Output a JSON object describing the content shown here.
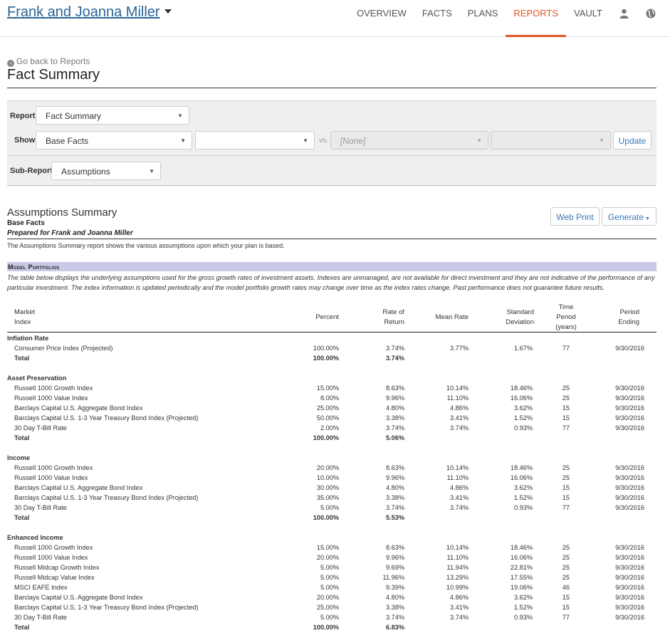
{
  "header": {
    "client_name": "Frank and Joanna Miller",
    "nav": [
      {
        "label": "OVERVIEW",
        "active": false
      },
      {
        "label": "FACTS",
        "active": false
      },
      {
        "label": "PLANS",
        "active": false
      },
      {
        "label": "REPORTS",
        "active": true
      },
      {
        "label": "VAULT",
        "active": false
      }
    ],
    "icons": [
      "user-icon",
      "globe-icon"
    ]
  },
  "page": {
    "back_link": "Go back to Reports",
    "title": "Fact Summary"
  },
  "controls": {
    "report_label": "Report:",
    "report_value": "Fact Summary",
    "show_label": "Show:",
    "show_value": "Base Facts",
    "show_value_2": "",
    "vs_label": "vs.",
    "compare_value": "[None]",
    "compare_value_2": "",
    "update_button": "Update",
    "subreport_label": "Sub-Report:",
    "subreport_value": "Assumptions"
  },
  "report": {
    "title": "Assumptions Summary",
    "subtitle": "Base Facts",
    "prepared_for": "Prepared for Frank and Joanna Miller",
    "description": "The Assumptions Summary report shows the various assumptions upon which your plan is based.",
    "web_print_button": "Web Print",
    "generate_button": "Generate",
    "section_heading": "Model Portfolios",
    "section_note": "The table below displays the underlying assumptions used for the gross growth rates of investment assets. Indexes are unmanaged, are not available for direct investment and they are not indicative of the performance of any particular investment. The index information is updated periodically and the model portfolio growth rates may change over time as the index rates change. Past performance does not guarantee future results."
  },
  "table": {
    "headers": {
      "market_index": [
        "Market",
        "Index"
      ],
      "percent": "Percent",
      "rate_of_return": [
        "Rate of",
        "Return"
      ],
      "mean_rate": "Mean Rate",
      "std_dev": [
        "Standard",
        "Deviation"
      ],
      "time_period": [
        "Time",
        "Period",
        "(years)"
      ],
      "period_ending": [
        "Period",
        "Ending"
      ]
    },
    "groups": [
      {
        "name": "Inflation Rate",
        "rows": [
          {
            "index": "Consumer Price Index (Projected)",
            "percent": "100.00%",
            "ror": "3.74%",
            "mean": "3.77%",
            "sd": "1.67%",
            "tp": "77",
            "pe": "9/30/2016"
          }
        ],
        "total": {
          "label": "Total",
          "percent": "100.00%",
          "ror": "3.74%"
        }
      },
      {
        "name": "Asset Preservation",
        "rows": [
          {
            "index": "Russell 1000 Growth Index",
            "percent": "15.00%",
            "ror": "8.63%",
            "mean": "10.14%",
            "sd": "18.46%",
            "tp": "25",
            "pe": "9/30/2016"
          },
          {
            "index": "Russell 1000 Value Index",
            "percent": "8.00%",
            "ror": "9.96%",
            "mean": "11.10%",
            "sd": "16.06%",
            "tp": "25",
            "pe": "9/30/2016"
          },
          {
            "index": "Barclays Capital U.S. Aggregate Bond Index",
            "percent": "25.00%",
            "ror": "4.80%",
            "mean": "4.86%",
            "sd": "3.62%",
            "tp": "15",
            "pe": "9/30/2016"
          },
          {
            "index": "Barclays Capital U.S. 1-3 Year Treasury Bond Index (Projected)",
            "percent": "50.00%",
            "ror": "3.38%",
            "mean": "3.41%",
            "sd": "1.52%",
            "tp": "15",
            "pe": "9/30/2016"
          },
          {
            "index": "30 Day T-Bill Rate",
            "percent": "2.00%",
            "ror": "3.74%",
            "mean": "3.74%",
            "sd": "0.93%",
            "tp": "77",
            "pe": "9/30/2016"
          }
        ],
        "total": {
          "label": "Total",
          "percent": "100.00%",
          "ror": "5.06%"
        }
      },
      {
        "name": "Income",
        "rows": [
          {
            "index": "Russell 1000 Growth Index",
            "percent": "20.00%",
            "ror": "8.63%",
            "mean": "10.14%",
            "sd": "18.46%",
            "tp": "25",
            "pe": "9/30/2016"
          },
          {
            "index": "Russell 1000 Value Index",
            "percent": "10.00%",
            "ror": "9.96%",
            "mean": "11.10%",
            "sd": "16.06%",
            "tp": "25",
            "pe": "9/30/2016"
          },
          {
            "index": "Barclays Capital U.S. Aggregate Bond Index",
            "percent": "30.00%",
            "ror": "4.80%",
            "mean": "4.86%",
            "sd": "3.62%",
            "tp": "15",
            "pe": "9/30/2016"
          },
          {
            "index": "Barclays Capital U.S. 1-3 Year Treasury Bond Index (Projected)",
            "percent": "35.00%",
            "ror": "3.38%",
            "mean": "3.41%",
            "sd": "1.52%",
            "tp": "15",
            "pe": "9/30/2016"
          },
          {
            "index": "30 Day T-Bill Rate",
            "percent": "5.00%",
            "ror": "3.74%",
            "mean": "3.74%",
            "sd": "0.93%",
            "tp": "77",
            "pe": "9/30/2016"
          }
        ],
        "total": {
          "label": "Total",
          "percent": "100.00%",
          "ror": "5.53%"
        }
      },
      {
        "name": "Enhanced Income",
        "rows": [
          {
            "index": "Russell 1000 Growth Index",
            "percent": "15.00%",
            "ror": "8.63%",
            "mean": "10.14%",
            "sd": "18.46%",
            "tp": "25",
            "pe": "9/30/2016"
          },
          {
            "index": "Russell 1000 Value Index",
            "percent": "20.00%",
            "ror": "9.96%",
            "mean": "11.10%",
            "sd": "16.06%",
            "tp": "25",
            "pe": "9/30/2016"
          },
          {
            "index": "Russell Midcap Growth Index",
            "percent": "5.00%",
            "ror": "9.69%",
            "mean": "11.94%",
            "sd": "22.81%",
            "tp": "25",
            "pe": "9/30/2016"
          },
          {
            "index": "Russell Midcap Value Index",
            "percent": "5.00%",
            "ror": "11.96%",
            "mean": "13.29%",
            "sd": "17.55%",
            "tp": "25",
            "pe": "9/30/2016"
          },
          {
            "index": "MSCI EAFE Index",
            "percent": "5.00%",
            "ror": "9.39%",
            "mean": "10.99%",
            "sd": "19.06%",
            "tp": "46",
            "pe": "9/30/2016"
          },
          {
            "index": "Barclays Capital U.S. Aggregate Bond Index",
            "percent": "20.00%",
            "ror": "4.80%",
            "mean": "4.86%",
            "sd": "3.62%",
            "tp": "15",
            "pe": "9/30/2016"
          },
          {
            "index": "Barclays Capital U.S. 1-3 Year Treasury Bond Index (Projected)",
            "percent": "25.00%",
            "ror": "3.38%",
            "mean": "3.41%",
            "sd": "1.52%",
            "tp": "15",
            "pe": "9/30/2016"
          },
          {
            "index": "30 Day T-Bill Rate",
            "percent": "5.00%",
            "ror": "3.74%",
            "mean": "3.74%",
            "sd": "0.93%",
            "tp": "77",
            "pe": "9/30/2016"
          }
        ],
        "total": {
          "label": "Total",
          "percent": "100.00%",
          "ror": "6.83%"
        }
      }
    ]
  }
}
